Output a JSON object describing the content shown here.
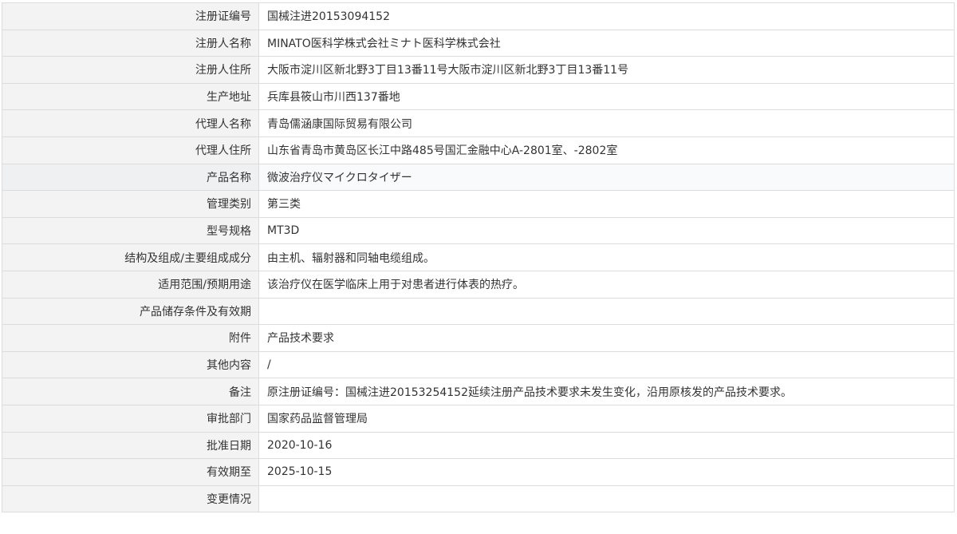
{
  "rows": [
    {
      "label": "注册证编号",
      "value": "国械注进20153094152"
    },
    {
      "label": "注册人名称",
      "value": "MINATO医科学株式会社ミナト医科学株式会社"
    },
    {
      "label": "注册人住所",
      "value": "大阪市淀川区新北野3丁目13番11号大阪市淀川区新北野3丁目13番11号"
    },
    {
      "label": "生产地址",
      "value": "兵库县筱山市川西137番地"
    },
    {
      "label": "代理人名称",
      "value": "青岛儒涵康国际贸易有限公司"
    },
    {
      "label": "代理人住所",
      "value": "山东省青岛市黄岛区长江中路485号国汇金融中心A-2801室、-2802室"
    },
    {
      "label": "产品名称",
      "value": "微波治疗仪マイクロタイザー"
    },
    {
      "label": "管理类别",
      "value": "第三类"
    },
    {
      "label": "型号规格",
      "value": "MT3D"
    },
    {
      "label": "结构及组成/主要组成成分",
      "value": "由主机、辐射器和同轴电缆组成。"
    },
    {
      "label": "适用范围/预期用途",
      "value": "该治疗仪在医学临床上用于对患者进行体表的热疗。"
    },
    {
      "label": "产品储存条件及有效期",
      "value": ""
    },
    {
      "label": "附件",
      "value": "产品技术要求"
    },
    {
      "label": "其他内容",
      "value": "/"
    },
    {
      "label": "备注",
      "value": "原注册证编号：国械注进20153254152延续注册产品技术要求未发生变化，沿用原核发的产品技术要求。"
    },
    {
      "label": "审批部门",
      "value": "国家药品监督管理局"
    },
    {
      "label": "批准日期",
      "value": "2020-10-16"
    },
    {
      "label": "有效期至",
      "value": "2025-10-15"
    },
    {
      "label": "变更情况",
      "value": ""
    }
  ]
}
